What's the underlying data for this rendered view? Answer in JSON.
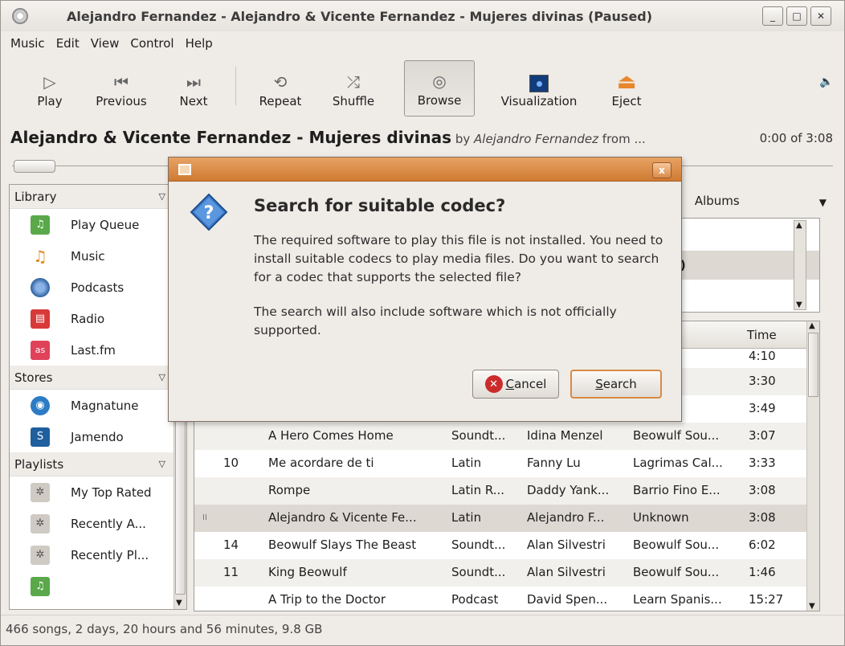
{
  "window": {
    "title": "Alejandro Fernandez - Alejandro & Vicente Fernandez - Mujeres divinas (Paused)",
    "wm_minimize": "_",
    "wm_maximize": "□",
    "wm_close": "✕"
  },
  "menu": [
    "Music",
    "Edit",
    "View",
    "Control",
    "Help"
  ],
  "toolbar": {
    "play": "Play",
    "previous": "Previous",
    "next": "Next",
    "repeat": "Repeat",
    "shuffle": "Shuffle",
    "browse": "Browse",
    "visualization": "Visualization",
    "eject": "Eject"
  },
  "now_playing": {
    "title": "Alejandro & Vicente Fernandez - Mujeres divinas",
    "by_prefix": " by ",
    "artist": "Alejandro Fernandez",
    "from_suffix": " from ...",
    "time": "0:00 of 3:08",
    "progress": 0
  },
  "sidebar": {
    "library_header": "Library",
    "library": [
      "Play Queue",
      "Music",
      "Podcasts",
      "Radio",
      "Last.fm"
    ],
    "stores_header": "Stores",
    "stores": [
      "Magnatune",
      "Jamendo"
    ],
    "playlists_header": "Playlists",
    "playlists": [
      "My Top Rated",
      "Recently A...",
      "Recently Pl...",
      ""
    ]
  },
  "browser": {
    "col_partial": "s",
    "albums_label": "Albums",
    "partial_row": "s)"
  },
  "tracklist": {
    "time_header": "Time",
    "partial_rows": [
      {
        "album": "wn",
        "time": "4:10"
      },
      {
        "album": "vn",
        "time": "3:30"
      },
      {
        "album": "vn",
        "time": "3:49"
      }
    ],
    "rows": [
      {
        "status": "",
        "num": "",
        "title": "A Hero Comes Home",
        "genre": "Soundt...",
        "artist": "Idina Menzel",
        "album": "Beowulf Sou...",
        "time": "3:07"
      },
      {
        "status": "",
        "num": "10",
        "title": "Me acordare de ti",
        "genre": "Latin",
        "artist": "Fanny Lu",
        "album": "Lagrimas Cal...",
        "time": "3:33"
      },
      {
        "status": "",
        "num": "",
        "title": "Rompe",
        "genre": "Latin R...",
        "artist": "Daddy Yank...",
        "album": "Barrio Fino E...",
        "time": "3:08"
      },
      {
        "status": "II",
        "num": "",
        "title": "Alejandro & Vicente Fe...",
        "genre": "Latin",
        "artist": "Alejandro F...",
        "album": "Unknown",
        "time": "3:08"
      },
      {
        "status": "",
        "num": "14",
        "title": "Beowulf Slays The Beast",
        "genre": "Soundt...",
        "artist": "Alan Silvestri",
        "album": "Beowulf Sou...",
        "time": "6:02"
      },
      {
        "status": "",
        "num": "11",
        "title": "King Beowulf",
        "genre": "Soundt...",
        "artist": "Alan Silvestri",
        "album": "Beowulf Sou...",
        "time": "1:46"
      },
      {
        "status": "",
        "num": "",
        "title": "A Trip to the Doctor",
        "genre": "Podcast",
        "artist": "David Spen...",
        "album": "Learn Spanis...",
        "time": "15:27"
      }
    ]
  },
  "statusbar": "466 songs, 2 days, 20 hours and 56 minutes, 9.8 GB",
  "dialog": {
    "close": "x",
    "heading": "Search for suitable codec?",
    "body1": "The required software to play this file is not installed. You need to install suitable codecs to play media files. Do you want to search for a codec that supports the selected file?",
    "body2": "The search will also include software which is not officially supported.",
    "cancel_mnemonic": "C",
    "cancel_rest": "ancel",
    "search_mnemonic": "S",
    "search_rest": "earch"
  }
}
